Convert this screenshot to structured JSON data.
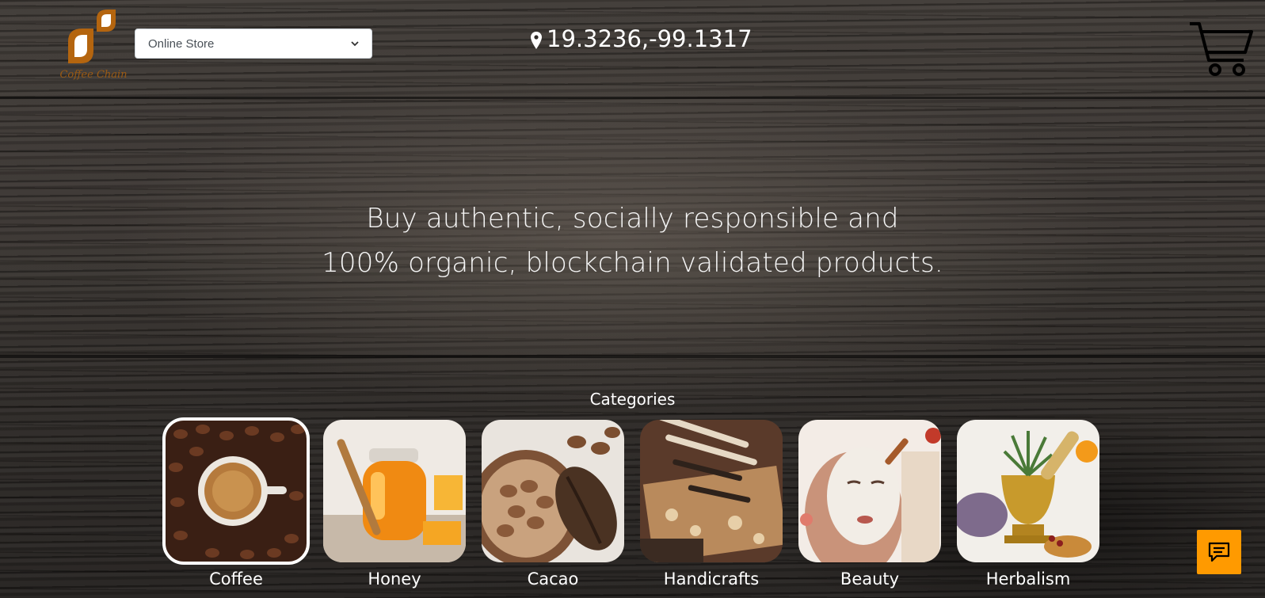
{
  "header": {
    "logo": {
      "caption": "Coffee Chain",
      "icon": "coffee-chain-leaf-logo",
      "color": "#b4650f"
    },
    "store_select": {
      "value": "Online Store",
      "icon": "chevron-down-icon"
    },
    "location": {
      "icon": "map-pin-icon",
      "coordinates": "19.3236,-99.1317"
    },
    "cart": {
      "icon": "shopping-cart-icon"
    }
  },
  "hero": {
    "line1": "Buy authentic, socially responsible and",
    "line2": "100% organic, blockchain validated products."
  },
  "categories": {
    "title": "Categories",
    "items": [
      {
        "label": "Coffee",
        "icon": "coffee-cup-image",
        "selected": true
      },
      {
        "label": "Honey",
        "icon": "honey-jar-image",
        "selected": false
      },
      {
        "label": "Cacao",
        "icon": "cacao-beans-image",
        "selected": false
      },
      {
        "label": "Handicrafts",
        "icon": "handicrafts-tools-image",
        "selected": false
      },
      {
        "label": "Beauty",
        "icon": "beauty-face-mask-image",
        "selected": false
      },
      {
        "label": "Herbalism",
        "icon": "herbal-mortar-image",
        "selected": false
      }
    ]
  },
  "chat": {
    "icon": "chat-message-icon",
    "color": "#ff9a00"
  }
}
